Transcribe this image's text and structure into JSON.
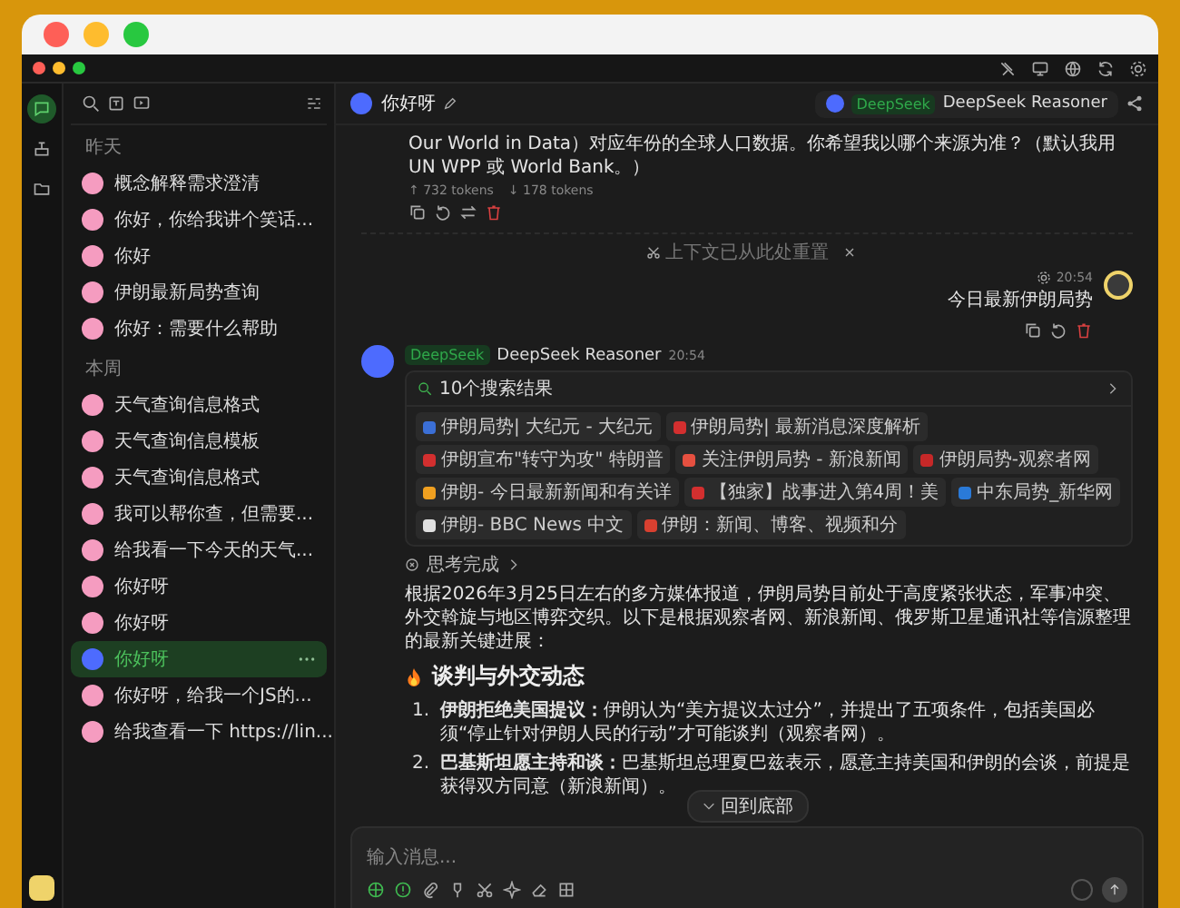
{
  "rail": [
    {
      "kind": "chat",
      "selected": true
    },
    {
      "kind": "agent",
      "selected": false
    },
    {
      "kind": "folder",
      "selected": false
    }
  ],
  "sidebar": {
    "sections": [
      {
        "heading": "昨天",
        "items": [
          {
            "title": "概念解释需求澄清",
            "selected": false
          },
          {
            "title": "你好，你给我讲个笑话...",
            "selected": false
          },
          {
            "title": "你好",
            "selected": false
          },
          {
            "title": "伊朗最新局势查询",
            "selected": false
          },
          {
            "title": "你好：需要什么帮助",
            "selected": false
          }
        ]
      },
      {
        "heading": "本周",
        "items": [
          {
            "title": "天气查询信息格式",
            "selected": false
          },
          {
            "title": "天气查询信息模板",
            "selected": false
          },
          {
            "title": "天气查询信息格式",
            "selected": false
          },
          {
            "title": "我可以帮你查，但需要...",
            "selected": false
          },
          {
            "title": "给我看一下今天的天气...",
            "selected": false
          },
          {
            "title": "你好呀",
            "selected": false
          },
          {
            "title": "你好呀",
            "selected": false
          },
          {
            "title": "你好呀",
            "selected": true
          },
          {
            "title": "你好呀，给我一个JS的...",
            "selected": false
          },
          {
            "title": "给我查看一下 https://lin...",
            "selected": false
          }
        ]
      }
    ]
  },
  "chat_header": {
    "title": "你好呀",
    "model_badge": "DeepSeek",
    "model_name": "DeepSeek Reasoner"
  },
  "previous_reply": {
    "text": "Our World in Data）对应年份的全球人口数据。你希望我以哪个来源为准？（默认我用 UN WPP 或 World Bank。）",
    "tokens_in": "↑ 732 tokens",
    "tokens_out": "↓ 178 tokens"
  },
  "context_divider": {
    "text": "上下文已从此处重置"
  },
  "user_message": {
    "time": "20:54",
    "text": "今日最新伊朗局势"
  },
  "assistant_message": {
    "model_badge": "DeepSeek",
    "model_name": "DeepSeek Reasoner",
    "time": "20:54",
    "search": {
      "title": "10个搜索结果",
      "results": [
        {
          "title": "伊朗局势| 大纪元 - 大纪元",
          "color": "#3b6fd6"
        },
        {
          "title": "伊朗局势| 最新消息深度解析",
          "color": "#d32f2f"
        },
        {
          "title": "伊朗宣布\"转守为攻\" 特朗普",
          "color": "#d32f2f"
        },
        {
          "title": "关注伊朗局势 - 新浪新闻",
          "color": "#e65040"
        },
        {
          "title": "伊朗局势-观察者网",
          "color": "#c62828"
        },
        {
          "title": "伊朗- 今日最新新闻和有关详",
          "color": "#f0a020"
        },
        {
          "title": "【独家】战事进入第4周！美",
          "color": "#d32f2f"
        },
        {
          "title": "中东局势_新华网",
          "color": "#2a7ad8"
        },
        {
          "title": "伊朗- BBC News 中文",
          "color": "#e0e0e0"
        },
        {
          "title": "伊朗：新闻、博客、视频和分",
          "color": "#d84030"
        }
      ]
    },
    "thinking": "思考完成",
    "intro": "根据2026年3月25日左右的多方媒体报道，伊朗局势目前处于高度紧张状态，军事冲突、外交斡旋与地区博弈交织。以下是根据观察者网、新浪新闻、俄罗斯卫星通讯社等信源整理的最新关键进展：",
    "heading": "谈判与外交动态",
    "points": [
      {
        "number": "1.",
        "text": "**伊朗拒绝美国提议：**伊朗认为“美方提议太过分”，并提出了五项条件，包括美国必须“停止针对伊朗人民的行动”才可能谈判（观察者网）。"
      },
      {
        "number": "2.",
        "text": "**巴基斯坦愿主持和谈：**巴基斯坦总理夏巴兹表示，愿意主持美国和伊朗的会谈，前提是获得双方同意（新浪新闻）。"
      }
    ]
  },
  "scroll_button": {
    "label": "回到底部"
  },
  "composer": {
    "placeholder": "输入消息...",
    "tools": [
      {
        "kind": "globe",
        "on": true
      },
      {
        "kind": "think",
        "on": true
      },
      {
        "kind": "attach",
        "on": false
      },
      {
        "kind": "bulb",
        "on": false
      },
      {
        "kind": "scissors",
        "on": false
      },
      {
        "kind": "sparkle",
        "on": false
      },
      {
        "kind": "eraser",
        "on": false
      },
      {
        "kind": "grid",
        "on": false
      }
    ]
  }
}
